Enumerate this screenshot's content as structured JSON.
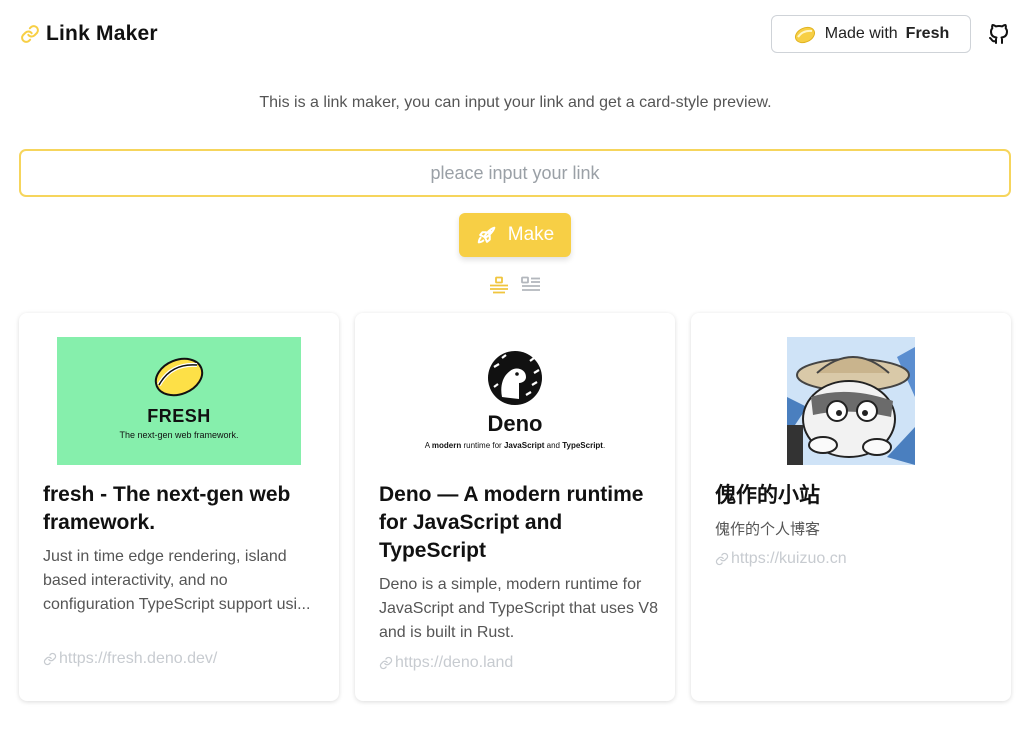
{
  "header": {
    "app_title": "Link Maker",
    "made_with_prefix": "Made with",
    "made_with_brand": "Fresh"
  },
  "intro": {
    "description": "This is a link maker, you can input your link and get a card-style preview."
  },
  "form": {
    "input_value": "",
    "input_placeholder": "pleace input your link",
    "make_label": "Make"
  },
  "view_toggle": {
    "options": [
      "center-layout-icon",
      "list-layout-icon"
    ],
    "selected": "center-layout-icon"
  },
  "colors": {
    "accent": "#f7cf45",
    "accent_border": "#f6d55c",
    "text_muted": "#555555",
    "link_muted": "#c7cbd0",
    "fresh_bg": "#86efac"
  },
  "cards": [
    {
      "image_title": "FRESH",
      "image_subtitle": "The next-gen web framework.",
      "title": "fresh - The next-gen web framework.",
      "description": "Just in time edge rendering, island based interactivity, and no configuration TypeScript support usi...",
      "url": "https://fresh.deno.dev/"
    },
    {
      "image_title": "Deno",
      "image_subtitle_parts": [
        "A ",
        "modern",
        " runtime for ",
        "JavaScript",
        " and ",
        "TypeScript",
        "."
      ],
      "title": "Deno — A modern runtime for JavaScript and TypeScript",
      "description": "Deno is a simple, modern runtime for JavaScript and TypeScript that uses V8 and is built in Rust.",
      "url": "https://deno.land"
    },
    {
      "title": "傀作的小站",
      "description": "傀作的个人博客",
      "url": "https://kuizuo.cn"
    }
  ]
}
